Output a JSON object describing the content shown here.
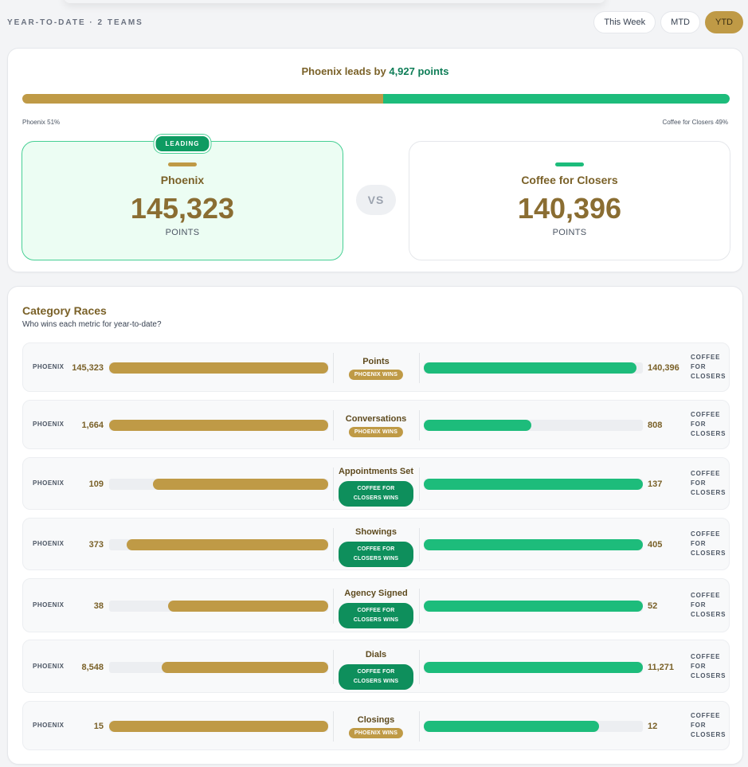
{
  "header": {
    "scope": "YEAR-TO-DATE · 2 TEAMS",
    "periods": [
      "This Week",
      "MTD",
      "YTD"
    ],
    "active_period": "YTD"
  },
  "summary": {
    "headline_prefix": "Phoenix leads by",
    "headline_points": "4,927 points",
    "split": {
      "phoenix_share": 0.51,
      "coffee_share": 0.49
    },
    "left_label": "Phoenix 51%",
    "right_label": "Coffee for Closers 49%",
    "leading_badge": "LEADING",
    "vs": "VS",
    "teams": [
      {
        "name": "Phoenix",
        "points": "145,323",
        "points_label": "POINTS"
      },
      {
        "name": "Coffee for Closers",
        "points": "140,396",
        "points_label": "POINTS"
      }
    ]
  },
  "races": {
    "title": "Category Races",
    "subtitle": "Who wins each metric for year-to-date?",
    "left_team": "PHOENIX",
    "right_team_lines": [
      "COFFEE",
      "FOR",
      "CLOSERS"
    ],
    "rows": [
      {
        "metric": "Points",
        "left": "145,323",
        "right": "140,396",
        "left_frac": 1.0,
        "right_frac": 0.97,
        "winner": "PHOENIX WINS",
        "winner_side": "left"
      },
      {
        "metric": "Conversations",
        "left": "1,664",
        "right": "808",
        "left_frac": 1.0,
        "right_frac": 0.49,
        "winner": "PHOENIX WINS",
        "winner_side": "left"
      },
      {
        "metric": "Appointments Set",
        "left": "109",
        "right": "137",
        "left_frac": 0.8,
        "right_frac": 1.0,
        "winner": "COFFEE FOR CLOSERS WINS",
        "winner_side": "right"
      },
      {
        "metric": "Showings",
        "left": "373",
        "right": "405",
        "left_frac": 0.92,
        "right_frac": 1.0,
        "winner": "COFFEE FOR CLOSERS WINS",
        "winner_side": "right"
      },
      {
        "metric": "Agency Signed",
        "left": "38",
        "right": "52",
        "left_frac": 0.73,
        "right_frac": 1.0,
        "winner": "COFFEE FOR CLOSERS WINS",
        "winner_side": "right"
      },
      {
        "metric": "Dials",
        "left": "8,548",
        "right": "11,271",
        "left_frac": 0.76,
        "right_frac": 1.0,
        "winner": "COFFEE FOR CLOSERS WINS",
        "winner_side": "right"
      },
      {
        "metric": "Closings",
        "left": "15",
        "right": "12",
        "left_frac": 1.0,
        "right_frac": 0.8,
        "winner": "PHOENIX WINS",
        "winner_side": "left"
      }
    ]
  },
  "colors": {
    "phoenix": "#bf9a46",
    "coffee": "#1dbc7b",
    "winner_green": "#0e8f5c",
    "title_brown": "#7a6128"
  }
}
